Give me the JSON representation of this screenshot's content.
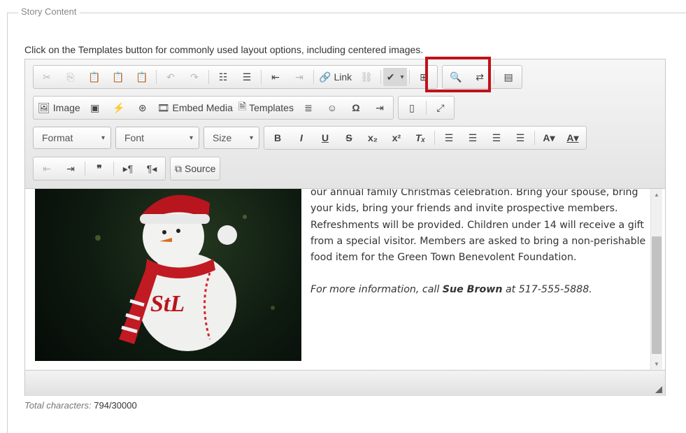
{
  "fieldset": {
    "legend": "Story Content"
  },
  "hint": "Click on the Templates button for commonly used layout options, including centered images.",
  "toolbar": {
    "link_label": "Link",
    "image_label": "Image",
    "embed_media_label": "Embed Media",
    "templates_label": "Templates",
    "source_label": "Source",
    "format_label": "Format",
    "font_label": "Font",
    "size_label": "Size"
  },
  "content": {
    "paragraph1": "our annual family Christmas celebration. Bring your spouse, bring your kids, bring your friends and invite prospective members. Refreshments will be provided. Children under 14 will receive a gift from a special visitor.  Members are asked to bring a non-perishable food item for the Green Town Benevolent Foundation.",
    "info_prefix": "For more information, call ",
    "info_name": "Sue Brown",
    "info_suffix": " at 517-555-5888."
  },
  "counter": {
    "label": "Total characters:",
    "value": "794/30000"
  },
  "colors": {
    "highlight": "#c0121a"
  }
}
